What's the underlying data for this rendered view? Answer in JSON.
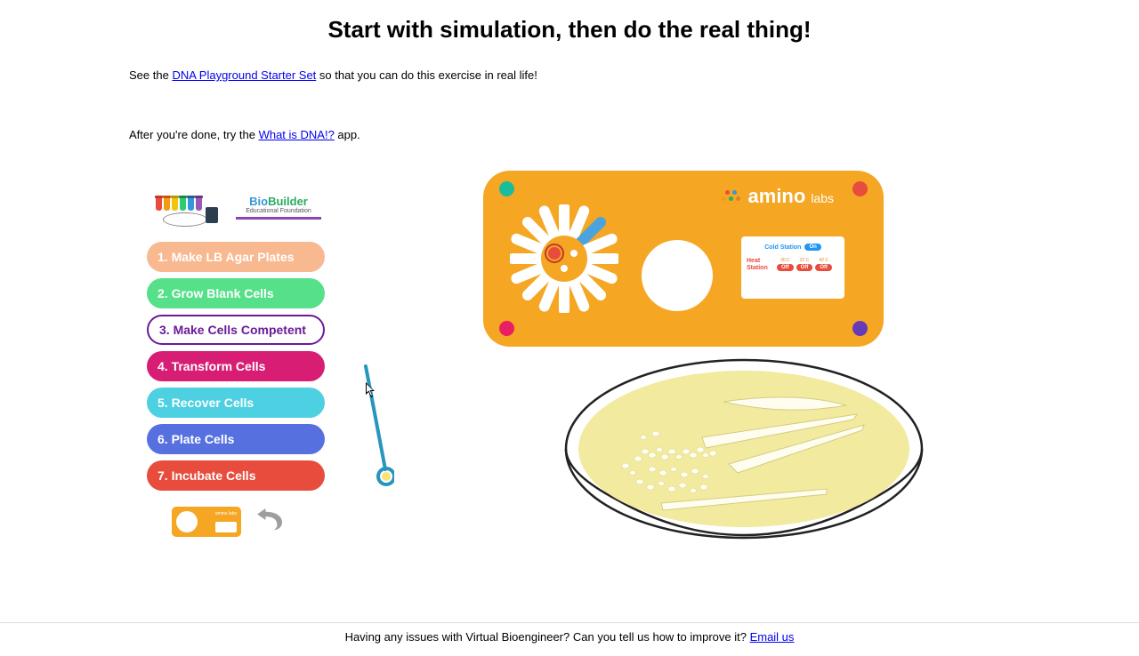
{
  "title": "Start with simulation, then do the real thing!",
  "intro": {
    "prefix": "See the ",
    "link_text": "DNA Playground Starter Set",
    "suffix": " so that you can do this exercise in real life!"
  },
  "intro2": {
    "prefix": "After you're done, try the ",
    "link_text": "What is DNA!?",
    "suffix": " app."
  },
  "logos": {
    "biobuilder_bio": "Bio",
    "biobuilder_builder": "Builder",
    "biobuilder_sub": "Educational Foundation"
  },
  "steps": [
    {
      "label": "1. Make LB Agar Plates",
      "color": "#f8b890",
      "active": false
    },
    {
      "label": "2.  Grow Blank Cells",
      "color": "#56e08a",
      "active": false
    },
    {
      "label": "3. Make Cells Competent",
      "color": "#ffffff",
      "active": true
    },
    {
      "label": "4. Transform Cells",
      "color": "#d81e74",
      "active": false
    },
    {
      "label": "5. Recover Cells",
      "color": "#4dd0e1",
      "active": false
    },
    {
      "label": "6. Plate Cells",
      "color": "#5670e0",
      "active": false
    },
    {
      "label": "7. Incubate Cells",
      "color": "#e74c3c",
      "active": false
    }
  ],
  "device": {
    "brand_a": "amino",
    "brand_b": "labs",
    "cold_station_label": "Cold Station",
    "cold_station_state": "On",
    "heat_station_label": "Heat\nStation",
    "temps": [
      {
        "value": "30 C",
        "state": "Off"
      },
      {
        "value": "37 C",
        "state": "Off"
      },
      {
        "value": "42 C",
        "state": "Off"
      }
    ]
  },
  "mini_panel_text": "amino labs",
  "footer": {
    "text": "Having any issues with Virtual Bioengineer? Can you tell us how to improve it? ",
    "link": "Email us"
  }
}
